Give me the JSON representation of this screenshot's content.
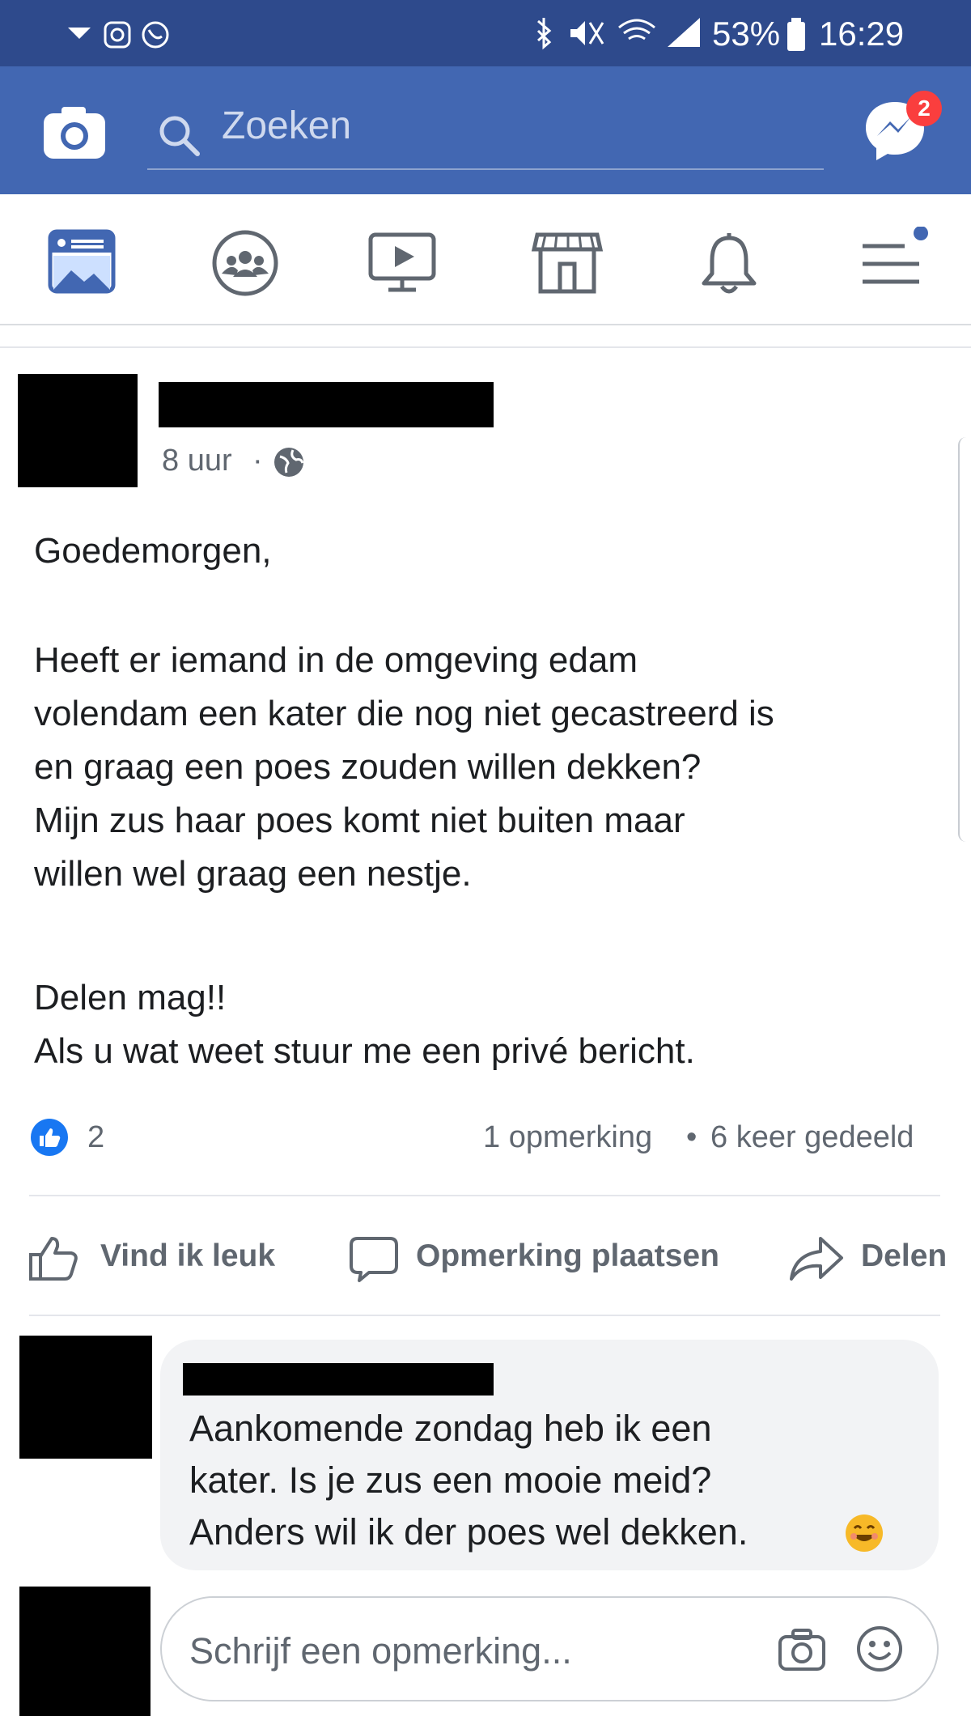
{
  "status_bar": {
    "battery": "53%",
    "time": "16:29"
  },
  "header": {
    "search_placeholder": "Zoeken",
    "messenger_badge": "2",
    "accent_color": "#4267b2"
  },
  "nav": {
    "icons": [
      "news-feed-icon",
      "groups-icon",
      "watch-icon",
      "marketplace-icon",
      "notifications-icon",
      "menu-icon"
    ]
  },
  "post": {
    "timestamp": "8 uur",
    "separator": "·",
    "paragraph1": "Goedemorgen,",
    "paragraph2": "Heeft er iemand in de omgeving edam\nvolendam een kater die nog niet gecastreerd is\nen graag een poes zouden willen dekken?\nMijn zus haar poes komt niet buiten maar\nwillen wel graag een nestje.",
    "paragraph3": "Delen mag!!\nAls u wat weet stuur me een privé bericht.",
    "like_count": "2",
    "comments_count": "1 opmerking",
    "shares_count": "6 keer gedeeld",
    "stats_separator": "•"
  },
  "actions": {
    "like": "Vind ik leuk",
    "comment": "Opmerking plaatsen",
    "share": "Delen"
  },
  "comment": {
    "text": "Aankomende zondag heb ik een\nkater. Is je zus een mooie meid?\nAnders wil ik der poes wel dekken."
  },
  "comment_input": {
    "placeholder": "Schrijf een opmerking..."
  }
}
